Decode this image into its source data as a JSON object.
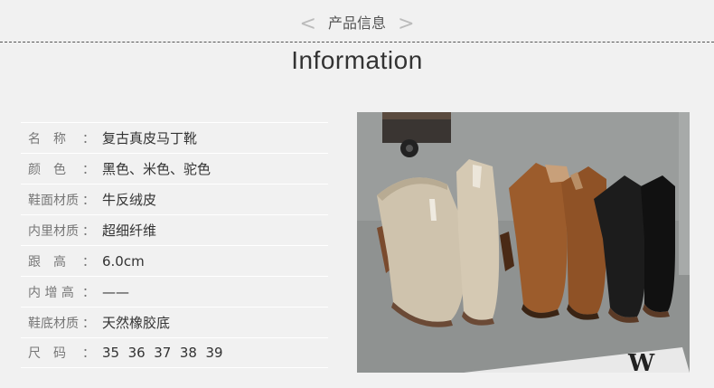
{
  "header": {
    "subtitle": "产品信息",
    "left_chevron": "<",
    "right_chevron": ">",
    "title": "Information"
  },
  "specs": [
    {
      "key": "名　称",
      "colon": "：",
      "value": "复古真皮马丁靴"
    },
    {
      "key": "颜　色",
      "colon": "：",
      "value": "黑色、米色、驼色"
    },
    {
      "key": "鞋面材质",
      "colon": "：",
      "value": "牛反绒皮"
    },
    {
      "key": "内里材质",
      "colon": "：",
      "value": "超细纤维"
    },
    {
      "key": "跟　高",
      "colon": "：",
      "value": "6.0cm"
    },
    {
      "key": "内 增 高",
      "colon": "：",
      "value": "——"
    },
    {
      "key": "鞋底材质",
      "colon": "：",
      "value": "天然橡胶底"
    },
    {
      "key": "尺　码",
      "colon": "：",
      "value": "35  36  37  38  39"
    }
  ],
  "photo": {
    "subject": "suede chelsea ankle boots in beige, tan and black on concrete floor"
  },
  "colors": {
    "background": "#f1f1f1",
    "boot_beige": "#cdbfa8",
    "boot_tan": "#9a5a2a",
    "boot_black": "#1a1a1a"
  }
}
